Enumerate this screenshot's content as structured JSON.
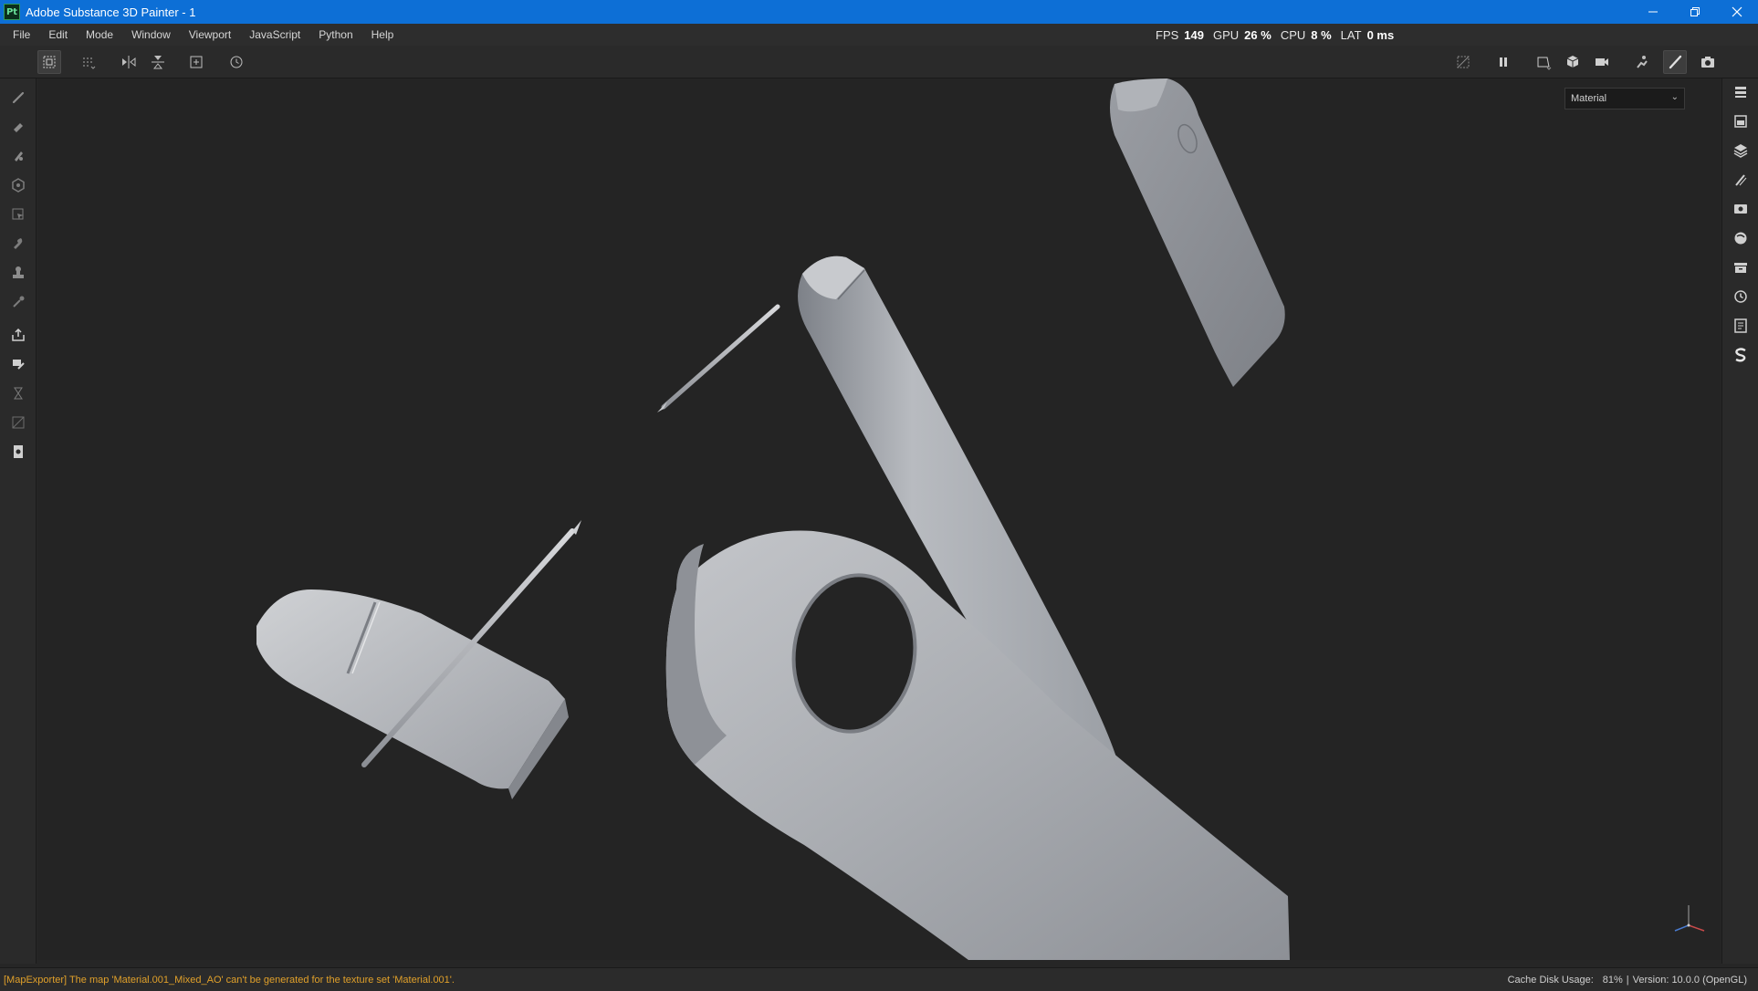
{
  "window": {
    "title": "Adobe Substance 3D Painter - 1",
    "logo_text": "Pt",
    "minimize_icon": "minimize-icon",
    "restore_icon": "restore-icon",
    "close_icon": "close-icon"
  },
  "menu": {
    "items": [
      {
        "label": "File"
      },
      {
        "label": "Edit"
      },
      {
        "label": "Mode"
      },
      {
        "label": "Window"
      },
      {
        "label": "Viewport"
      },
      {
        "label": "JavaScript"
      },
      {
        "label": "Python"
      },
      {
        "label": "Help"
      }
    ]
  },
  "stats": {
    "fps_label": "FPS",
    "fps_value": "149",
    "gpu_label": "GPU",
    "gpu_value": "26 %",
    "cpu_label": "CPU",
    "cpu_value": "8 %",
    "lat_label": "LAT",
    "lat_value": "0 ms"
  },
  "viewport": {
    "channel_selected": "Material"
  },
  "status": {
    "message": "[MapExporter] The map 'Material.001_Mixed_AO' can't be generated for the texture set 'Material.001'.",
    "cache_label": "Cache Disk Usage:",
    "cache_value": "81%",
    "separator": "|",
    "version": "Version: 10.0.0 (OpenGL)"
  },
  "colors": {
    "titlebar": "#0d6fd6",
    "warning": "#e0a02a",
    "model": "#a9acb1"
  }
}
